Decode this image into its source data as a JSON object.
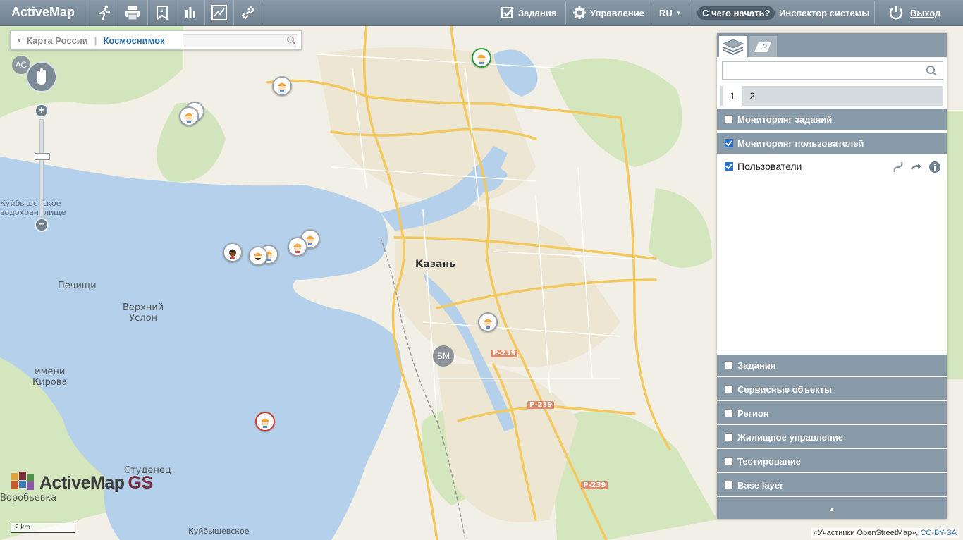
{
  "app": {
    "brand": "ActiveMap"
  },
  "topbar": {
    "tools": [
      {
        "icon": "running-person-icon"
      },
      {
        "icon": "printer-icon"
      },
      {
        "icon": "bookmark-icon"
      },
      {
        "icon": "bar-chart-icon"
      },
      {
        "icon": "line-chart-icon"
      },
      {
        "icon": "link-icon"
      }
    ],
    "tasks_label": "Задания",
    "manage_label": "Управление",
    "lang_label": "RU",
    "getting_started_label": "С чего начать?",
    "inspector_label": "Инспектор системы",
    "logout_label": "Выход"
  },
  "map": {
    "basemap_switcher": {
      "option1": "Карта России",
      "option2": "Космоснимок",
      "search_placeholder": ""
    },
    "ac_label": "АС",
    "labels": {
      "kazan": "Казань",
      "pechishchi": "Печищи",
      "verkhny_uslon": "Верхний\nУслон",
      "imeni_kirova": "имени\nКирова",
      "studenets": "Студенец",
      "vorobyevka": "Воробьевка",
      "kuybyshevskoe": "Куйбышевское",
      "reservoir": "Куйбышевское\nводохранилище",
      "road_1": "Р-239",
      "road_2": "Р-239",
      "road_3": "Р-239"
    },
    "bm_label": "БМ",
    "logo_text": "ActiveMap",
    "logo_suffix": "GS",
    "scale_label": "2 km",
    "attribution": "«Участники OpenStreetMap», ",
    "license": "CC-BY-SA"
  },
  "panel": {
    "search_placeholder": "",
    "pages": [
      "1",
      "2"
    ],
    "layers": [
      {
        "label": "Мониторинг заданий",
        "checked": false
      },
      {
        "label": "Мониторинг пользователей",
        "checked": true
      },
      {
        "label": "Задания",
        "checked": false
      },
      {
        "label": "Сервисные объекты",
        "checked": false
      },
      {
        "label": "Регион",
        "checked": false
      },
      {
        "label": "Жилищное управление",
        "checked": false
      },
      {
        "label": "Тестирование",
        "checked": false
      },
      {
        "label": "Base layer",
        "checked": false
      }
    ],
    "sublayer": {
      "label": "Пользователи",
      "checked": true
    }
  }
}
